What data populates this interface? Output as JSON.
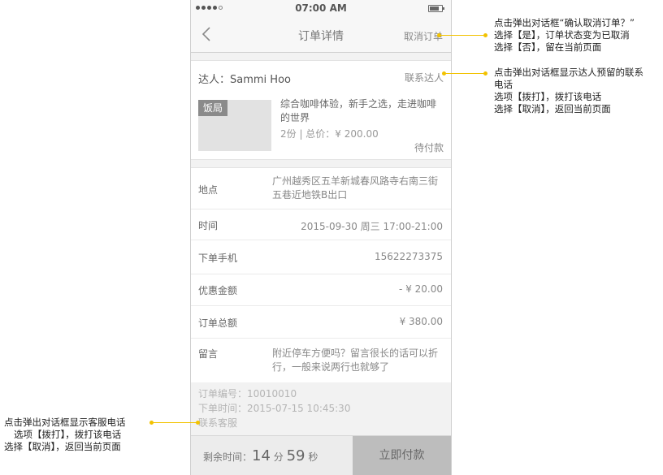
{
  "status_bar": {
    "time": "07:00 AM"
  },
  "nav": {
    "title": "订单详情",
    "action": "取消订单"
  },
  "order": {
    "expert_label": "达人：Sammi Hoo",
    "contact": "联系达人",
    "tag": "饭局",
    "product_title": "综合咖啡体验，新手之选，走进咖啡的世界",
    "product_meta": "2份  |  总价：¥ 200.00",
    "status": "待付款"
  },
  "details": [
    {
      "label": "地点",
      "value": "广州越秀区五羊新城春风路寺右南三街五巷近地铁B出口"
    },
    {
      "label": "时间",
      "value": "2015-09-30 周三 17:00-21:00"
    },
    {
      "label": "下单手机",
      "value": "15622273375"
    },
    {
      "label": "优惠金额",
      "value": "- ¥ 20.00"
    },
    {
      "label": "订单总额",
      "value": "¥ 380.00"
    },
    {
      "label": "留言",
      "value": "附近停车方便吗？留言很长的话可以折行，一般来说两行也就够了"
    }
  ],
  "meta": {
    "order_no": "订单编号：10010010",
    "order_time": "下单时间：2015-07-15 10:45:30",
    "service": "联系客服"
  },
  "bottom": {
    "remain_label": "剩余时间：",
    "minutes": "14",
    "min_unit": "分",
    "seconds": "59",
    "sec_unit": "秒",
    "pay": "立即付款"
  },
  "annotations": {
    "cancel": [
      "点击弹出对话框“确认取消订单？”",
      "选择【是】，订单状态变为已取消",
      "选择【否】，留在当前页面"
    ],
    "contact": [
      "点击弹出对话框显示达人预留的联系",
      "电话",
      "选项【拨打】，拨打该电话",
      "选择【取消】，返回当前页面"
    ],
    "service": [
      "点击弹出对话框显示客服电话",
      "选项【拨打】，拨打该电话",
      "选择【取消】，返回当前页面"
    ]
  },
  "colors": {
    "accent": "#f2c200",
    "pay_button": "#bdbdbd",
    "tag": "#8a8a8a"
  }
}
